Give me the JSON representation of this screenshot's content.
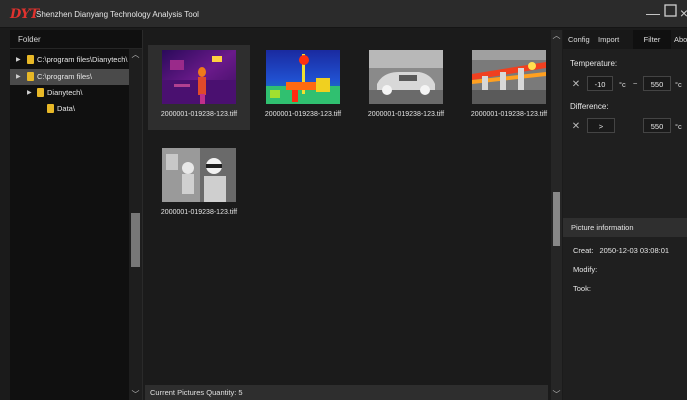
{
  "window": {
    "logo": "DYT",
    "title": "Shenzhen Dianyang Technology Analysis Tool"
  },
  "folder_panel": {
    "title": "Folder",
    "tree": [
      {
        "label": "C:\\program files\\Dianytech\\",
        "expandable": true,
        "selected": false
      },
      {
        "label": "C:\\program files\\",
        "expandable": true,
        "selected": true
      },
      {
        "label": "Dianytech\\",
        "expandable": true,
        "selected": false
      },
      {
        "label": "Data\\",
        "expandable": false,
        "selected": false
      }
    ]
  },
  "thumbnails": [
    {
      "name": "2000001-019238-123.tiff",
      "palette": "iron",
      "selected": true
    },
    {
      "name": "2000001-019238-123.tiff",
      "palette": "rainbow",
      "selected": false
    },
    {
      "name": "2000001-019238-123.tiff",
      "palette": "grayscale",
      "selected": false
    },
    {
      "name": "2000001-019238-123.tiff",
      "palette": "iron-highlight",
      "selected": false
    },
    {
      "name": "2000001-019238-123.tiff",
      "palette": "grayscale",
      "selected": false
    }
  ],
  "status": {
    "text": "Current Pictures Quantity: 5"
  },
  "right_panel": {
    "tabs": [
      "Config",
      "Import",
      "Filter",
      "Abo"
    ],
    "active_tab": "Filter",
    "temperature": {
      "label": "Temperature:",
      "min": "-10",
      "unit_min": "°c",
      "separator": "~",
      "max": "550",
      "unit_max": "°c"
    },
    "difference": {
      "label": "Difference:",
      "operator": ">",
      "value": "550",
      "unit": "°c"
    },
    "picture_info": {
      "title": "Picture information",
      "creat_label": "Creat:",
      "creat_value": "2050-12-03 03:08:01",
      "modify_label": "Modify:",
      "took_label": "Took:"
    }
  },
  "colors": {
    "accent_folder": "#e8b827",
    "logo_red": "#e0322e",
    "background": "#1b1b1b",
    "selected_row": "#4a4a4a"
  }
}
